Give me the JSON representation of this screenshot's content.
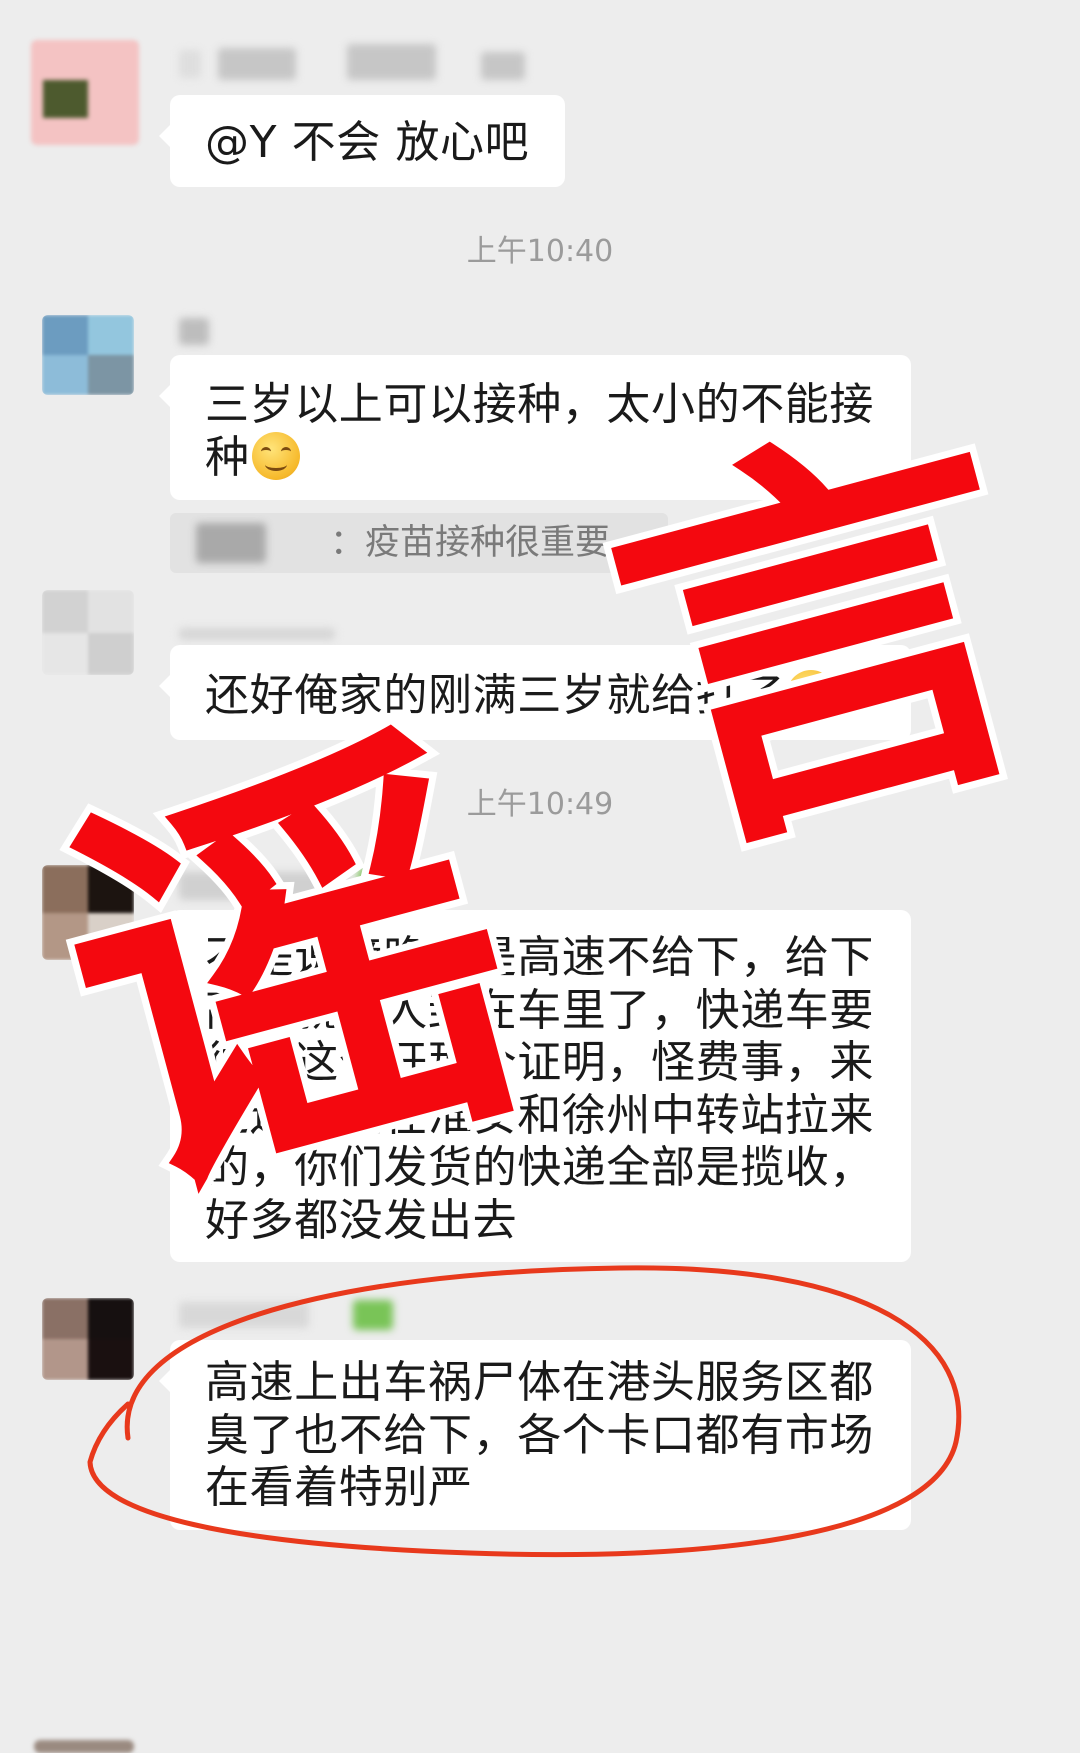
{
  "chat": {
    "background": "#ededed",
    "msg1": {
      "text": "@Y 不会 放心吧"
    },
    "time1": "上午10:40",
    "msg2": {
      "lines": [
        "三岁以上可以接种，太小的不能接",
        "种"
      ],
      "emoji_icon": "grinning-face-emoji-icon",
      "quote_text": "：疫苗接种很重要"
    },
    "msg3": {
      "text": "还好俺家的刚满三岁就给打了",
      "emoji_icon": "laughing-face-emoji-icon"
    },
    "time2": "上午10:49",
    "msg4": {
      "lines": [
        "不是说傍晚，是高速不给下，给下",
        "高速就把人封在车里了，快递车要",
        "得开这个开那个证明，怪费事，来",
        "这边都是在淮安和徐州中转站拉来",
        "的，你们发货的快递全部是揽收，",
        "好多都没发出去"
      ]
    },
    "msg5": {
      "lines": [
        "高速上出车祸尸体在港头服务区都",
        "臭了也不给下，各个卡口都有市场",
        "在看着特别严"
      ]
    }
  },
  "stamp": {
    "chars": [
      "谣",
      "言"
    ],
    "color": "#f4080f",
    "outline": "#ffffff"
  },
  "highlight": {
    "color": "#e8391c"
  }
}
